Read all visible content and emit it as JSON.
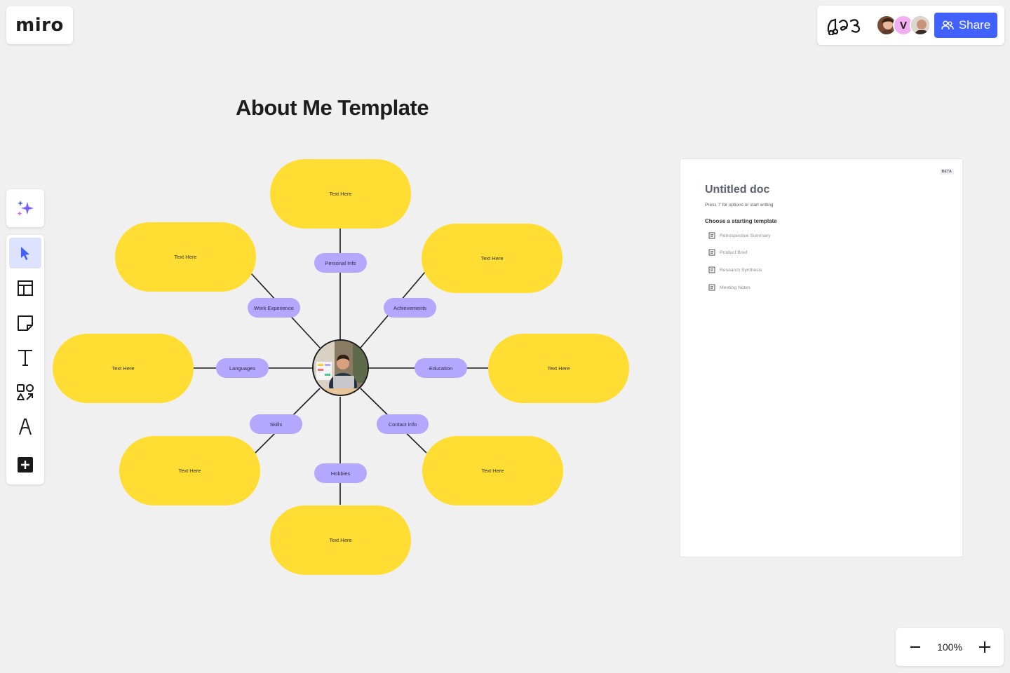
{
  "app": {
    "logo": "miro"
  },
  "header": {
    "share_label": "Share",
    "avatars": [
      {
        "name": "avatar-user-1",
        "initial": ""
      },
      {
        "name": "avatar-user-2",
        "initial": "V"
      },
      {
        "name": "avatar-user-3",
        "initial": ""
      }
    ],
    "brand_color": "#4262ff"
  },
  "toolbar": {
    "tools": [
      "ai-sparkle-icon",
      "select-cursor-icon",
      "templates-icon",
      "sticky-note-icon",
      "text-icon",
      "shapes-icon",
      "pen-icon",
      "add-more-icon"
    ],
    "active_tool": "select-cursor-icon"
  },
  "board": {
    "title": "About Me Template",
    "center_photo": "person-working-at-laptop-photo",
    "categories": {
      "personal_info": "Personal Info",
      "work_experience": "Work Experience",
      "achievements": "Achievements",
      "languages": "Languages",
      "education": "Education",
      "skills": "Skills",
      "contact_info": "Contact Info",
      "hobbies": "Hobbies"
    },
    "placeholder_text": "Text Here",
    "colors": {
      "pill_yellow": "#ffdd33",
      "pill_purple": "#b3a7ff"
    }
  },
  "doc": {
    "badge": "BETA",
    "title": "Untitled doc",
    "hint": "Press '/' for options or start writing",
    "choose_label": "Choose a starting template",
    "templates": [
      "Retrospective Summary",
      "Product Brief",
      "Research Synthesis",
      "Meeting Notes"
    ]
  },
  "zoom": {
    "value": "100%"
  }
}
